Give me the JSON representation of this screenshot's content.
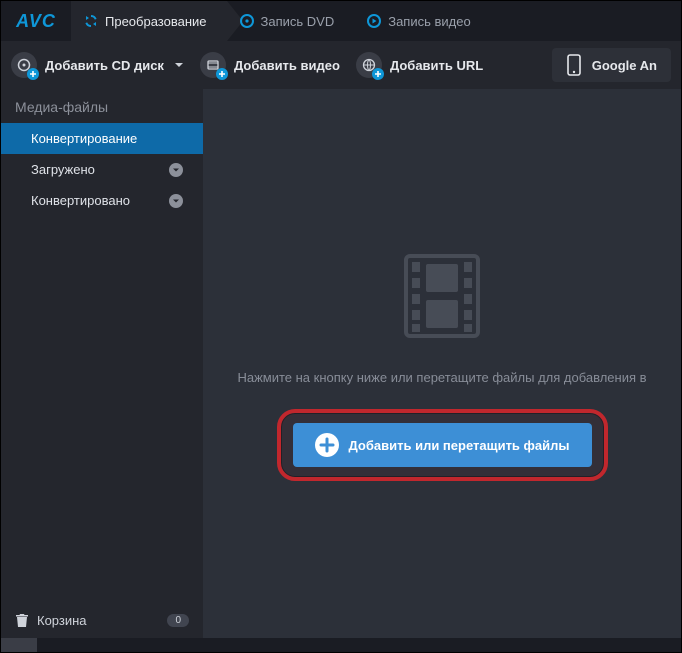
{
  "brand": "AVC",
  "tabs": [
    {
      "label": "Преобразование",
      "active": true
    },
    {
      "label": "Запись DVD",
      "active": false
    },
    {
      "label": "Запись видео",
      "active": false
    }
  ],
  "toolbar": {
    "add_cd": "Добавить CD диск",
    "add_video": "Добавить видео",
    "add_url": "Добавить URL",
    "device": "Google An"
  },
  "sidebar": {
    "title": "Медиа-файлы",
    "items": [
      {
        "label": "Конвертирование",
        "active": true,
        "badge": false
      },
      {
        "label": "Загружено",
        "active": false,
        "badge": true
      },
      {
        "label": "Конвертировано",
        "active": false,
        "badge": true
      }
    ],
    "trash": {
      "label": "Корзина",
      "count": "0"
    }
  },
  "content": {
    "hint": "Нажмите на кнопку ниже или перетащите файлы для добавления в",
    "add_button": "Добавить или перетащить файлы"
  }
}
